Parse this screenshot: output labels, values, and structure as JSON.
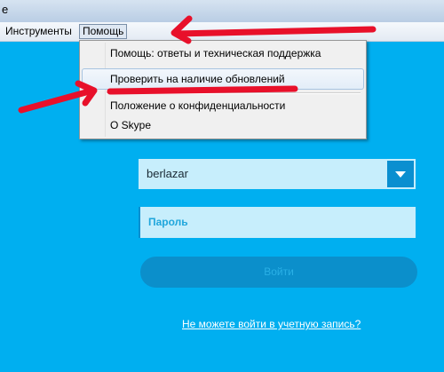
{
  "titlebar": {
    "letter": "e"
  },
  "menubar": {
    "items": [
      {
        "label": "Инструменты"
      },
      {
        "label": "Помощь"
      }
    ]
  },
  "dropdown": {
    "items": [
      {
        "label": "Помощь: ответы и техническая поддержка"
      },
      {
        "label": "Проверить на наличие обновлений"
      },
      {
        "label": "Положение о конфиденциальности"
      },
      {
        "label": "О Skype"
      }
    ]
  },
  "login": {
    "username": "berlazar",
    "password_placeholder": "Пароль",
    "signin_label": "Войти",
    "cant_sign_in_link": "Не можете войти в учетную запись?"
  },
  "colors": {
    "background": "#00aff0",
    "annotation": "#e8102a"
  }
}
